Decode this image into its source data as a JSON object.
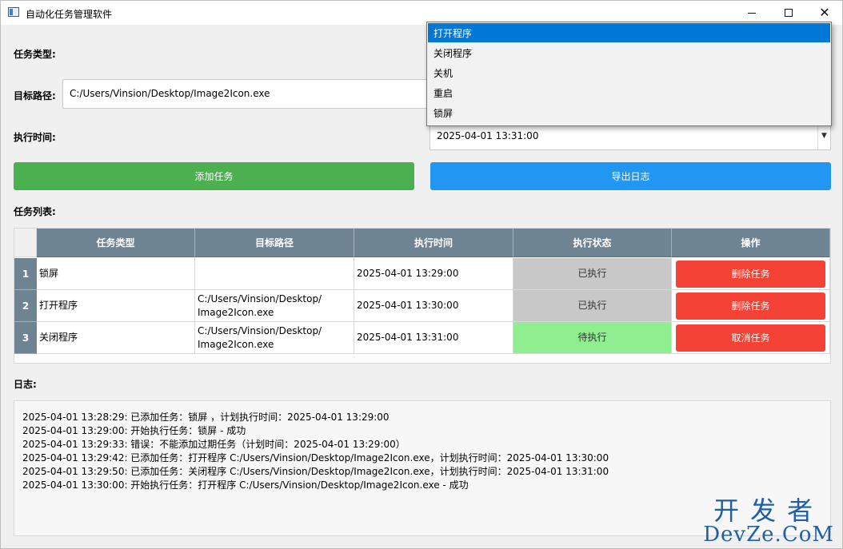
{
  "window": {
    "title": "自动化任务管理软件",
    "minimize": "minimize",
    "maximize": "maximize",
    "close": "✕"
  },
  "form": {
    "task_type_label": "任务类型:",
    "target_path_label": "目标路径:",
    "target_path_value": "C:/Users/Vinsion/Desktop/Image2Icon.exe",
    "exec_time_label": "执行时间:",
    "exec_time_value": "2025-04-01 13:31:00"
  },
  "dropdown": {
    "options": [
      "打开程序",
      "关闭程序",
      "关机",
      "重启",
      "锁屏"
    ],
    "selected_index": 0
  },
  "buttons": {
    "add_task": "添加任务",
    "export_log": "导出日志"
  },
  "task_list": {
    "label": "任务列表:",
    "columns": [
      "任务类型",
      "目标路径",
      "执行时间",
      "执行状态",
      "操作"
    ],
    "rows": [
      {
        "index": "1",
        "type": "锁屏",
        "path": "",
        "time": "2025-04-01 13:29:00",
        "status": "已执行",
        "action": "删除任务"
      },
      {
        "index": "2",
        "type": "打开程序",
        "path": "C:/Users/Vinsion/Desktop/\nImage2Icon.exe",
        "time": "2025-04-01 13:30:00",
        "status": "已执行",
        "action": "删除任务"
      },
      {
        "index": "3",
        "type": "关闭程序",
        "path": "C:/Users/Vinsion/Desktop/\nImage2Icon.exe",
        "time": "2025-04-01 13:31:00",
        "status": "待执行",
        "action": "取消任务"
      }
    ]
  },
  "log": {
    "label": "日志:",
    "lines": [
      "2025-04-01 13:28:29: 已添加任务：锁屏 ，计划执行时间：2025-04-01 13:29:00",
      "2025-04-01 13:29:00: 开始执行任务：锁屏  - 成功",
      "2025-04-01 13:29:33: 错误：不能添加过期任务（计划时间：2025-04-01 13:29:00）",
      "2025-04-01 13:29:42: 已添加任务：打开程序 C:/Users/Vinsion/Desktop/Image2Icon.exe，计划执行时间：2025-04-01 13:30:00",
      "2025-04-01 13:29:50: 已添加任务：关闭程序 C:/Users/Vinsion/Desktop/Image2Icon.exe，计划执行时间：2025-04-01 13:31:00",
      "2025-04-01 13:30:00: 开始执行任务：打开程序 C:/Users/Vinsion/Desktop/Image2Icon.exe - 成功"
    ]
  },
  "watermark": {
    "cn": "开发者",
    "en": "DevZe.CoM"
  },
  "colors": {
    "add_button": "#4caf50",
    "export_button": "#2196f3",
    "action_button": "#f44336",
    "header": "#6f8493",
    "status_done": "#c8c8c8",
    "status_pending": "#90ee90",
    "dropdown_selected": "#0078d7"
  }
}
